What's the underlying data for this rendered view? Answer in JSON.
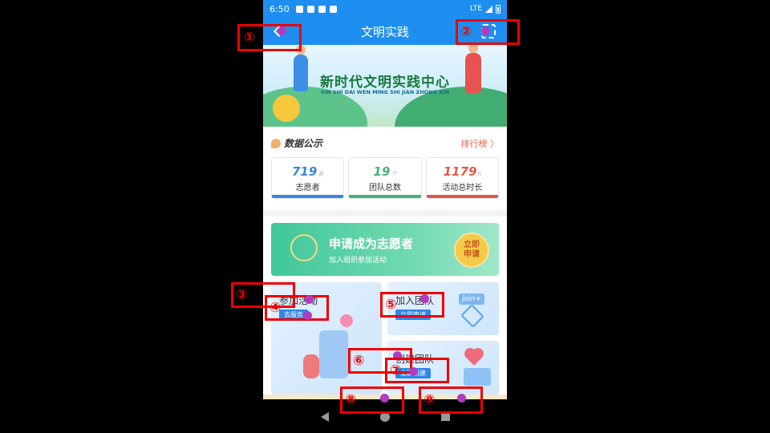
{
  "status_bar": {
    "time": "6:50",
    "network": "LTE"
  },
  "app_bar": {
    "title": "文明实践",
    "back_icon": "back-icon",
    "scan_icon": "scan-icon"
  },
  "banner": {
    "title": "新时代文明实践中心",
    "subtitle": "XIN SHI DAI WEN MING SHI JIAN ZHONG XIN"
  },
  "stats": {
    "heading": "数据公示",
    "ranking_link": "排行榜 〉",
    "cards": [
      {
        "value": "719",
        "unit": "名",
        "label": "志愿者",
        "color": "#3a86d8"
      },
      {
        "value": "19",
        "unit": "个",
        "label": "团队总数",
        "color": "#48b07a"
      },
      {
        "value": "1179",
        "unit": "h",
        "label": "活动总时长",
        "color": "#e05a4a"
      }
    ]
  },
  "apply_banner": {
    "title": "申请成为志愿者",
    "subtitle": "加入组织参加活动",
    "button": "立即\n申请"
  },
  "tiles": {
    "join_activity": {
      "title": "参加活动",
      "tag": "去服务"
    },
    "join_team": {
      "title": "加入团队",
      "tag": "立即申请",
      "badge": "join+"
    },
    "create_team": {
      "title": "创建团队",
      "tag": "立即创建"
    }
  },
  "annotations": [
    "①",
    "②",
    "③",
    "④",
    "⑤",
    "⑥",
    "⑦",
    "⑧",
    "⑨"
  ],
  "colors": {
    "primary": "#1e8ff0",
    "annotation": "#e00000",
    "marker": "#b03cc0"
  }
}
